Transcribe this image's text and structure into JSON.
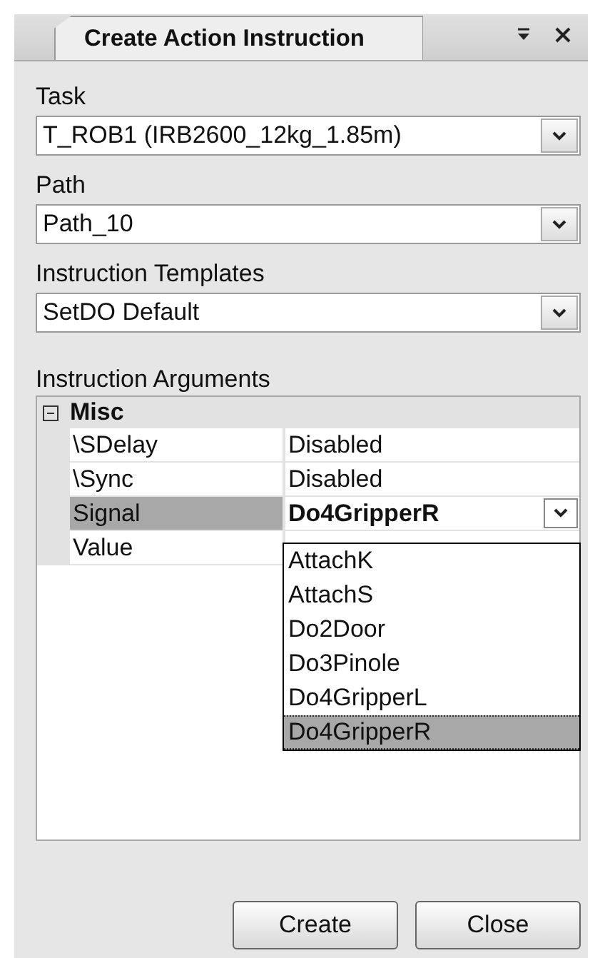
{
  "panel": {
    "title": "Create Action Instruction"
  },
  "fields": [
    {
      "label": "Task",
      "value": "T_ROB1 (IRB2600_12kg_1.85m)"
    },
    {
      "label": "Path",
      "value": "Path_10"
    },
    {
      "label": "Instruction Templates",
      "value": "SetDO Default"
    }
  ],
  "arguments": {
    "label": "Instruction Arguments",
    "category": {
      "name": "Misc",
      "expanded": true
    },
    "rows": [
      {
        "name": "\\SDelay",
        "value": "Disabled",
        "selected": false,
        "kind": "text"
      },
      {
        "name": "\\Sync",
        "value": "Disabled",
        "selected": false,
        "kind": "text"
      },
      {
        "name": "Signal",
        "value": "Do4GripperR",
        "selected": true,
        "kind": "dropdown"
      },
      {
        "name": "Value",
        "selected": false,
        "kind": "text"
      }
    ]
  },
  "dropdown": {
    "items": [
      {
        "label": "AttachK",
        "selected": false
      },
      {
        "label": "AttachS",
        "selected": false
      },
      {
        "label": "Do2Door",
        "selected": false
      },
      {
        "label": "Do3Pinole",
        "selected": false
      },
      {
        "label": "Do4GripperL",
        "selected": false
      },
      {
        "label": "Do4GripperR",
        "selected": true
      }
    ]
  },
  "buttons": [
    {
      "label": "Create"
    },
    {
      "label": "Close"
    }
  ]
}
